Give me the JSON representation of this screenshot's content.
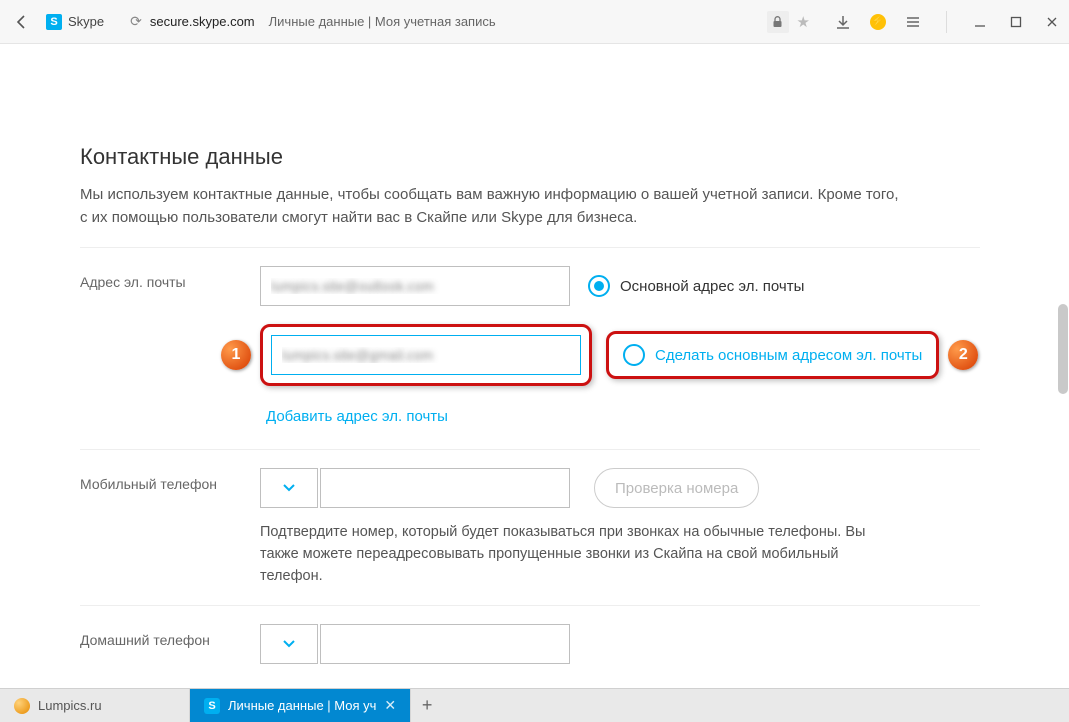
{
  "browser": {
    "site_name": "Skype",
    "url_host": "secure.skype.com",
    "page_title": "Личные данные | Моя учетная запись"
  },
  "section": {
    "title": "Контактные данные",
    "description": "Мы используем контактные данные, чтобы сообщать вам важную информацию о вашей учетной записи. Кроме того, с их помощью пользователи смогут найти вас в Скайпе или Skype для бизнеса."
  },
  "email": {
    "label": "Адрес эл. почты",
    "primary_value": "lumpics.site@outlook.com",
    "primary_radio": "Основной адрес эл. почты",
    "secondary_value": "lumpics.site@gmail.com",
    "secondary_radio": "Сделать основным адресом эл. почты",
    "add_link": "Добавить адрес эл. почты"
  },
  "mobile": {
    "label": "Мобильный телефон",
    "verify": "Проверка номера",
    "desc": "Подтвердите номер, который будет показываться при звонках на обычные телефоны. Вы также можете переадресовывать пропущенные звонки из Скайпа на свой мобильный телефон."
  },
  "home": {
    "label": "Домашний телефон"
  },
  "callouts": {
    "one": "1",
    "two": "2"
  },
  "tabs": {
    "lumpics": "Lumpics.ru",
    "skype": "Личные данные | Моя уч"
  }
}
